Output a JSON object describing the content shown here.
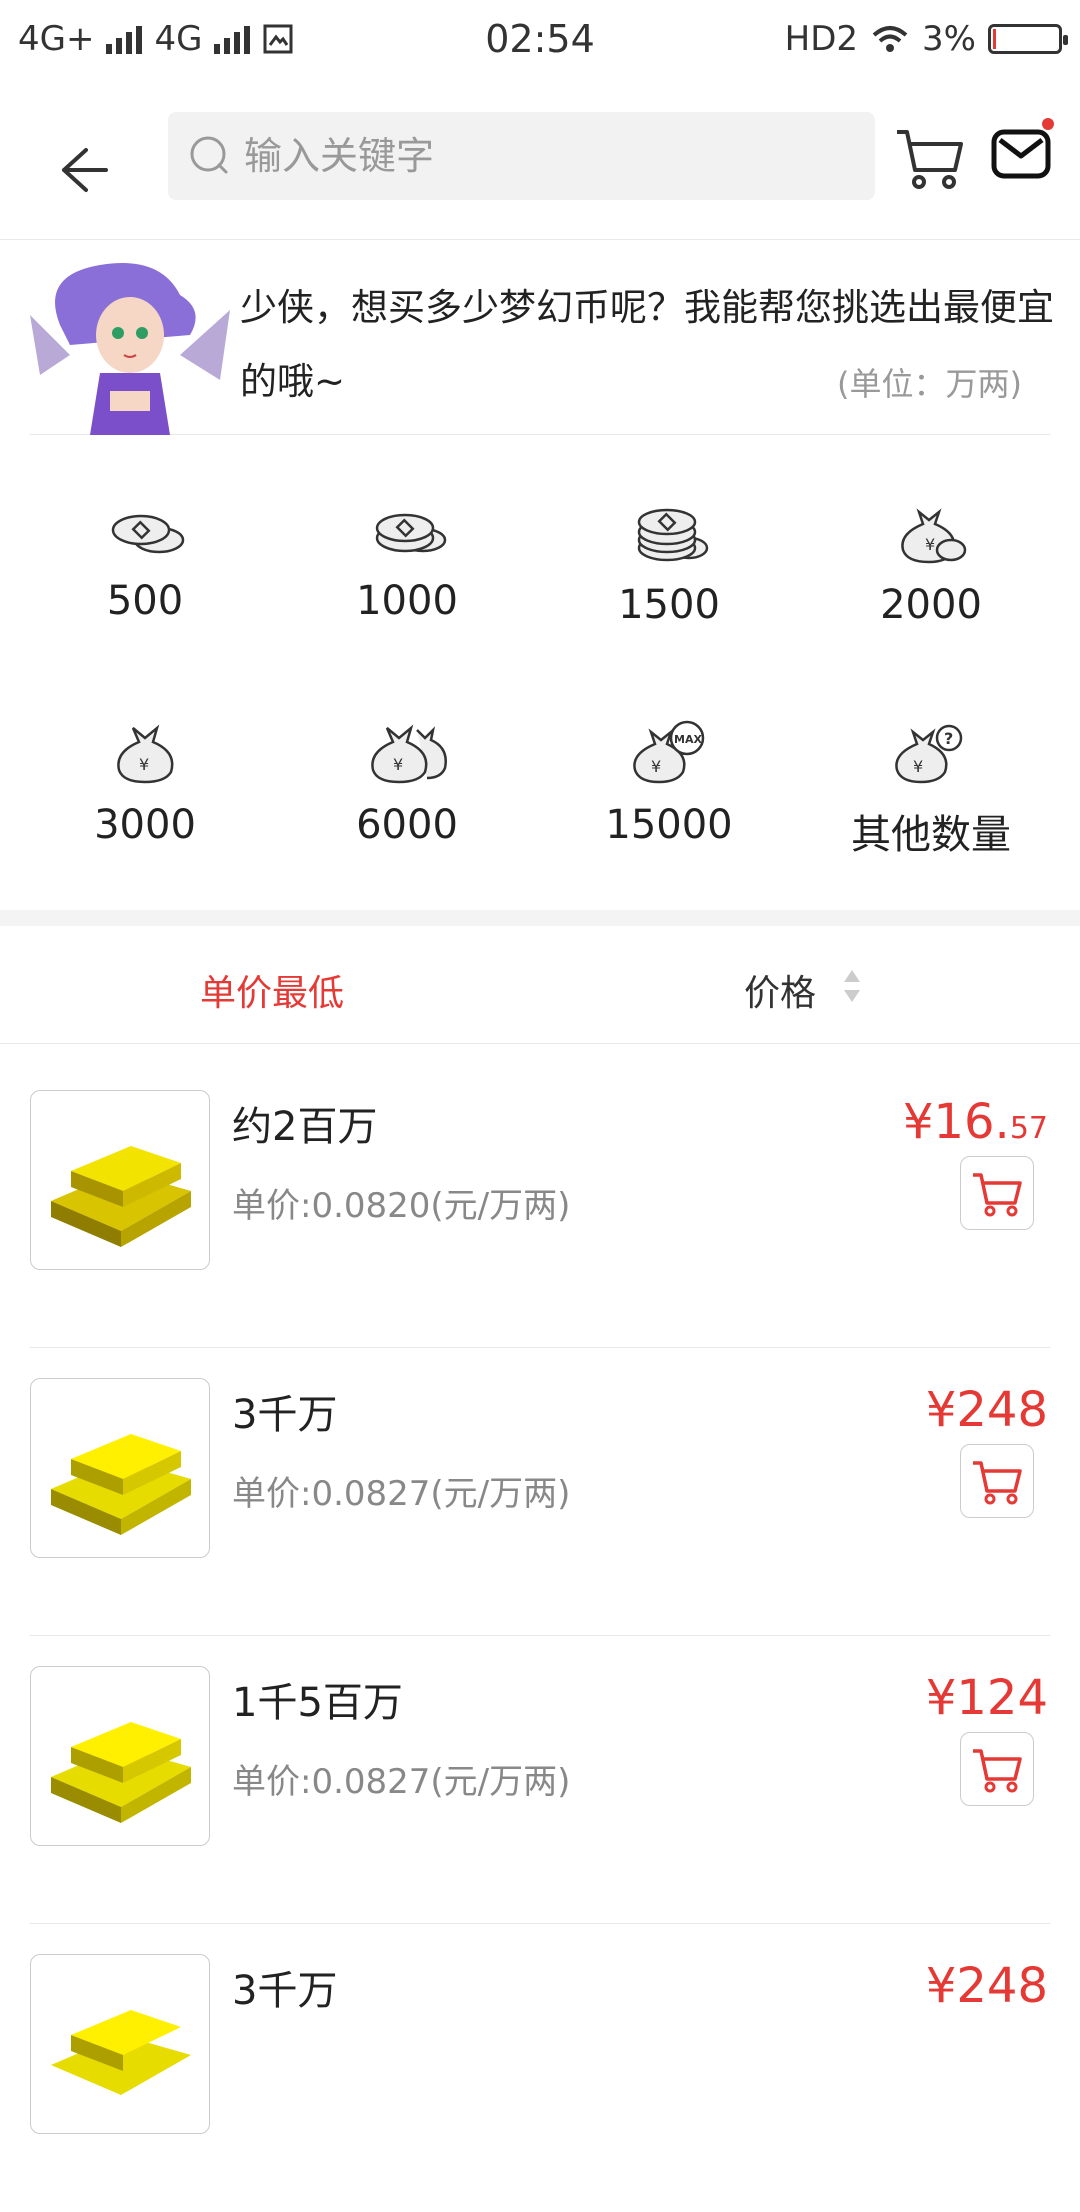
{
  "status_bar": {
    "network_left": "4G+",
    "network_right": "4G",
    "time": "02:54",
    "hd": "HD2",
    "battery": "3%",
    "battery_level": 0.03
  },
  "header": {
    "search_placeholder": "输入关键字"
  },
  "intro": {
    "text": "少侠，想买多少梦幻币呢？我能帮您挑选出最便宜的哦~",
    "unit": "(单位：万两)"
  },
  "amounts": [
    {
      "label": "500",
      "icon": "coins-small-icon"
    },
    {
      "label": "1000",
      "icon": "coins-stack-icon"
    },
    {
      "label": "1500",
      "icon": "coins-tall-stack-icon"
    },
    {
      "label": "2000",
      "icon": "money-bag-icon"
    },
    {
      "label": "3000",
      "icon": "money-bag-icon"
    },
    {
      "label": "6000",
      "icon": "money-bags-icon"
    },
    {
      "label": "15000",
      "icon": "money-bag-max-icon"
    },
    {
      "label": "其他数量",
      "icon": "money-bag-question-icon"
    }
  ],
  "sort": {
    "lowest_unit_price": "单价最低",
    "price": "价格"
  },
  "listings": [
    {
      "name": "约2百万",
      "unit_price": "单价:0.0820(元/万两)",
      "price_main": "¥16.",
      "price_frac": "57"
    },
    {
      "name": "3千万",
      "unit_price": "单价:0.0827(元/万两)",
      "price_main": "¥248",
      "price_frac": ""
    },
    {
      "name": "1千5百万",
      "unit_price": "单价:0.0827(元/万两)",
      "price_main": "¥124",
      "price_frac": ""
    },
    {
      "name": "3千万",
      "unit_price": "",
      "price_main": "¥248",
      "price_frac": ""
    }
  ],
  "colors": {
    "accent": "#e53935",
    "muted": "#888888"
  }
}
